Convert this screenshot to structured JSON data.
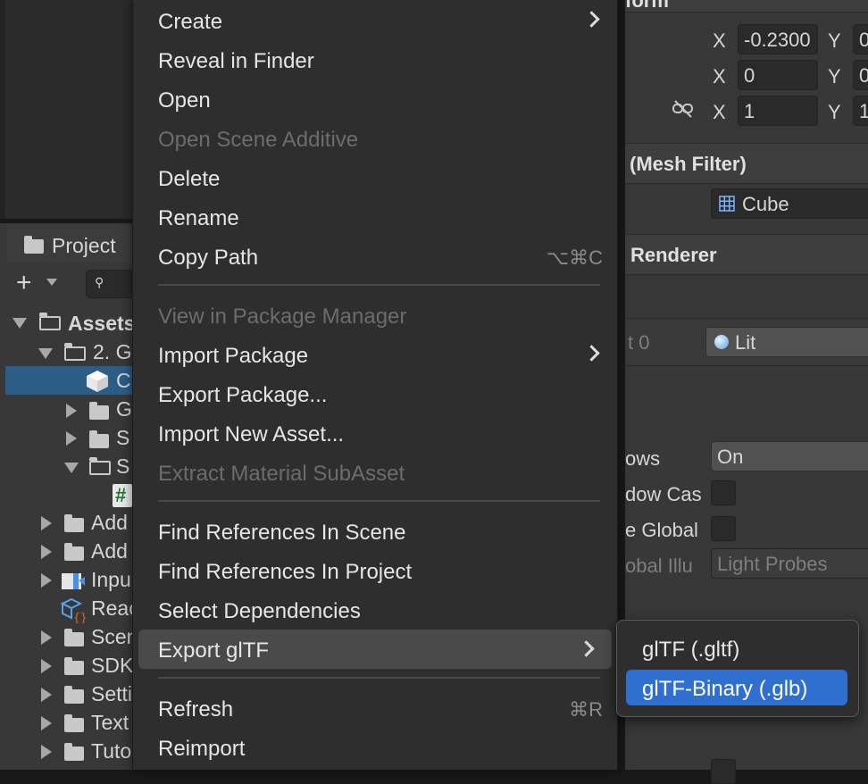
{
  "project_panel": {
    "tab_label": "Project",
    "add_label": "+",
    "tree": [
      {
        "label": "Assets"
      },
      {
        "label": "2. G"
      },
      {
        "label": "C"
      },
      {
        "label": "G"
      },
      {
        "label": "S"
      },
      {
        "label": "S"
      },
      {
        "label": "#"
      },
      {
        "label": "Add"
      },
      {
        "label": "Add"
      },
      {
        "label": "Inpu"
      },
      {
        "label": "Reac"
      },
      {
        "label": "Scen"
      },
      {
        "label": "SDK"
      },
      {
        "label": "Setti"
      },
      {
        "label": "Text"
      },
      {
        "label": "Tuto"
      }
    ]
  },
  "inspector": {
    "transform": {
      "title": "form",
      "position": {
        "x_label": "X",
        "x": "-0.2300",
        "y_label": "Y",
        "y": "0"
      },
      "rotation": {
        "x_label": "X",
        "x": "0",
        "y_label": "Y",
        "y": "0"
      },
      "scale": {
        "x_label": "X",
        "x": "1",
        "y_label": "Y",
        "y": "1"
      }
    },
    "mesh_filter": {
      "title": "(Mesh Filter)",
      "mesh_value": "Cube"
    },
    "renderer": {
      "title": "Renderer",
      "element_label": "t 0",
      "material_value": "Lit",
      "cast_shadows_label": "ows",
      "cast_shadows_value": "On",
      "shadow_label": "dow Cas",
      "global_label": "e Global",
      "illum_label": "obal Illu",
      "illum_value": "Light Probes"
    }
  },
  "context_menu": {
    "items": [
      {
        "label": "Create",
        "submenu": true
      },
      {
        "label": "Reveal in Finder"
      },
      {
        "label": "Open"
      },
      {
        "label": "Open Scene Additive",
        "disabled": true
      },
      {
        "label": "Delete"
      },
      {
        "label": "Rename"
      },
      {
        "label": "Copy Path",
        "shortcut": "⌥⌘C"
      },
      {
        "label": "View in Package Manager",
        "disabled": true
      },
      {
        "label": "Import Package",
        "submenu": true
      },
      {
        "label": "Export Package..."
      },
      {
        "label": "Import New Asset..."
      },
      {
        "label": "Extract Material SubAsset",
        "disabled": true
      },
      {
        "label": "Find References In Scene"
      },
      {
        "label": "Find References In Project"
      },
      {
        "label": "Select Dependencies"
      },
      {
        "label": "Export glTF",
        "submenu": true,
        "hover": true
      },
      {
        "label": "Refresh",
        "shortcut": "⌘R"
      },
      {
        "label": "Reimport"
      }
    ]
  },
  "submenu": {
    "items": [
      {
        "label": "glTF (.gltf)"
      },
      {
        "label": "glTF-Binary (.glb)",
        "active": true
      }
    ]
  },
  "colors": {
    "selection_blue": "#2f6fd0",
    "tree_selection": "#2c5d87",
    "menu_bg": "#2e2e2e"
  }
}
